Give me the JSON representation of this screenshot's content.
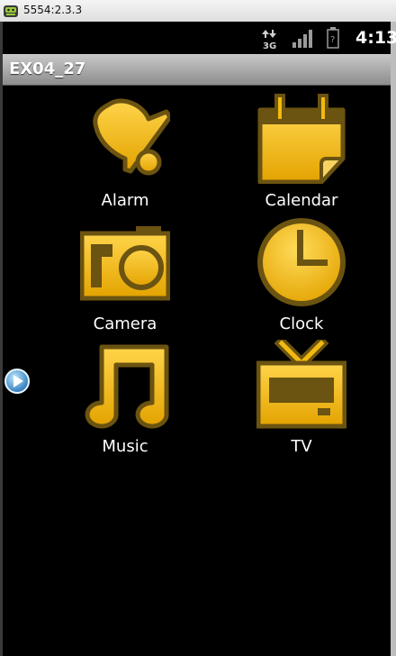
{
  "host_window": {
    "title": "5554:2.3.3",
    "icon": "android-emulator-icon"
  },
  "status_bar": {
    "network_icon": "3g-data-icon",
    "signal_icon": "signal-strength-icon",
    "battery_icon": "battery-icon",
    "time": "4:13"
  },
  "app_bar": {
    "title": "EX04_27"
  },
  "launcher": {
    "items": [
      {
        "label": "Alarm",
        "icon": "alarm-bell-icon"
      },
      {
        "label": "Calendar",
        "icon": "calendar-icon"
      },
      {
        "label": "Camera",
        "icon": "camera-icon"
      },
      {
        "label": "Clock",
        "icon": "clock-icon"
      },
      {
        "label": "Music",
        "icon": "music-note-icon"
      },
      {
        "label": "TV",
        "icon": "tv-icon"
      }
    ]
  },
  "colors": {
    "icon_fill": "#f2b90f",
    "icon_outline": "#6b5311",
    "status_bar": "#000000",
    "app_bar": "#a9a9a9",
    "background": "#000000",
    "label": "#ffffff"
  }
}
